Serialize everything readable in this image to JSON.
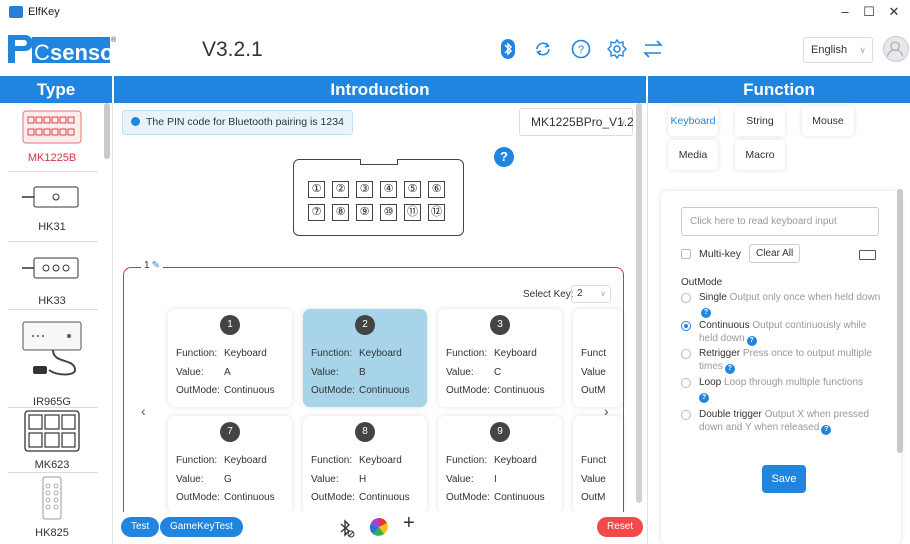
{
  "window": {
    "title": "ElfKey",
    "minimize": "–",
    "maximize": "☐",
    "close": "✕"
  },
  "header": {
    "version": "V3.2.1",
    "language": "English"
  },
  "panels": {
    "type": "Type",
    "intro": "Introduction",
    "function": "Function"
  },
  "types": [
    {
      "label": "MK1225B",
      "active": true
    },
    {
      "label": "HK31",
      "active": false
    },
    {
      "label": "HK33",
      "active": false
    },
    {
      "label": "IR965G",
      "active": false
    },
    {
      "label": "MK623",
      "active": false
    },
    {
      "label": "HK825",
      "active": false
    }
  ],
  "intro": {
    "pin_notice": "The PIN code for Bluetooth pairing is 1234",
    "model": "MK1225BPro_V1.2",
    "help": "?",
    "device_keys": [
      "①",
      "②",
      "③",
      "④",
      "⑤",
      "⑥",
      "⑦",
      "⑧",
      "⑨",
      "⑩",
      "⑪",
      "⑫"
    ],
    "group_label": "1",
    "select_key_label": "Select Key:",
    "select_key_value": "2",
    "prev": "‹",
    "next": "›",
    "labels": {
      "function": "Function:",
      "value": "Value:",
      "outmode": "OutMode:"
    },
    "keys": [
      {
        "num": "1",
        "function": "Keyboard",
        "value": "A",
        "outmode": "Continuous"
      },
      {
        "num": "2",
        "function": "Keyboard",
        "value": "B",
        "outmode": "Continuous"
      },
      {
        "num": "3",
        "function": "Keyboard",
        "value": "C",
        "outmode": "Continuous"
      },
      {
        "num": "7",
        "function": "Keyboard",
        "value": "G",
        "outmode": "Continuous"
      },
      {
        "num": "8",
        "function": "Keyboard",
        "value": "H",
        "outmode": "Continuous"
      },
      {
        "num": "9",
        "function": "Keyboard",
        "value": "I",
        "outmode": "Continuous"
      }
    ],
    "partial": [
      {
        "function": "Funct",
        "value": "Value",
        "outmode": "OutM"
      },
      {
        "function": "Funct",
        "value": "Value",
        "outmode": "OutM"
      }
    ],
    "buttons": {
      "test": "Test",
      "gamekeytest": "GameKeyTest",
      "add": "+",
      "reset": "Reset"
    }
  },
  "function": {
    "tabs": [
      "Keyboard",
      "String",
      "Mouse",
      "Media",
      "Macro"
    ],
    "active_tab": "Keyboard",
    "input_placeholder": "Click here to read keyboard input",
    "multikey": "Multi-key",
    "clear_all": "Clear All",
    "outmode_label": "OutMode",
    "options": [
      {
        "name": "Single",
        "desc": "Output only once when held down",
        "selected": false
      },
      {
        "name": "Continuous",
        "desc": "Output continuously while held down",
        "selected": true
      },
      {
        "name": "Retrigger",
        "desc": "Press once to output multiple times",
        "selected": false
      },
      {
        "name": "Loop",
        "desc": "Loop through multiple functions",
        "selected": false
      },
      {
        "name": "Double trigger",
        "desc": "Output X when pressed down and Y when released",
        "selected": false
      }
    ],
    "save": "Save",
    "help": "?"
  },
  "colors": {
    "accent": "#1f85de",
    "danger": "#f04a4a",
    "selected_card": "#a8d4ea",
    "group_border": "#d9333f"
  }
}
